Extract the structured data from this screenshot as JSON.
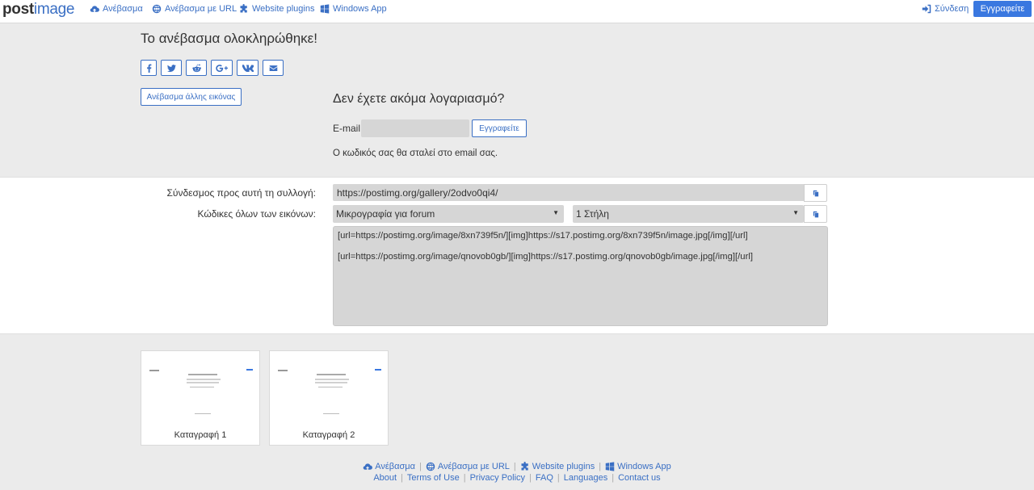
{
  "header": {
    "logo_post": "post",
    "logo_image": "image",
    "nav": [
      {
        "label": "Ανέβασμα",
        "icon": "cloud-upload-icon"
      },
      {
        "label": "Ανέβασμα με URL",
        "icon": "globe-icon"
      },
      {
        "label": "Website plugins",
        "icon": "puzzle-icon"
      },
      {
        "label": "Windows App",
        "icon": "windows-icon"
      }
    ],
    "login_label": "Σύνδεση",
    "register_label": "Εγγραφείτε"
  },
  "upload": {
    "title": "Το ανέβασμα ολοκληρώθηκε!",
    "share_icons": [
      "facebook-icon",
      "twitter-icon",
      "reddit-icon",
      "google-plus-icon",
      "vk-icon",
      "email-icon"
    ],
    "another_button": "Ανέβασμα άλλης εικόνας"
  },
  "account": {
    "title": "Δεν έχετε ακόμα λογαριασμό?",
    "email_label": "E-mail:",
    "email_value": "",
    "register_button": "Εγγραφείτε",
    "note": "Ο κωδικός σας θα σταλεί στο email σας."
  },
  "links": {
    "gallery_label": "Σύνδεσμος προς αυτή τη συλλογή:",
    "gallery_url": "https://postimg.org/gallery/2odvo0qi4/",
    "codes_label": "Κώδικες όλων των εικόνων:",
    "format_selected": "Μικρογραφία για forum",
    "columns_selected": "1 Στήλη",
    "codes": [
      "[url=https://postimg.org/image/8xn739f5n/][img]https://s17.postimg.org/8xn739f5n/image.jpg[/img][/url]",
      "[url=https://postimg.org/image/qnovob0gb/][img]https://s17.postimg.org/qnovob0gb/image.jpg[/img][/url]"
    ]
  },
  "thumbnails": [
    {
      "caption": "Καταγραφή 1"
    },
    {
      "caption": "Καταγραφή 2"
    }
  ],
  "footer": {
    "row1": [
      {
        "label": "Ανέβασμα",
        "icon": "cloud-upload-icon"
      },
      {
        "label": "Ανέβασμα με URL",
        "icon": "globe-icon"
      },
      {
        "label": "Website plugins",
        "icon": "puzzle-icon"
      },
      {
        "label": "Windows App",
        "icon": "windows-icon"
      }
    ],
    "row2": [
      "About",
      "Terms of Use",
      "Privacy Policy",
      "FAQ",
      "Languages",
      "Contact us"
    ]
  },
  "colors": {
    "accent": "#3a6fc4",
    "primary_button": "#3a78e0",
    "page_bg": "#ebebeb",
    "field_bg": "#d6d6d6"
  }
}
